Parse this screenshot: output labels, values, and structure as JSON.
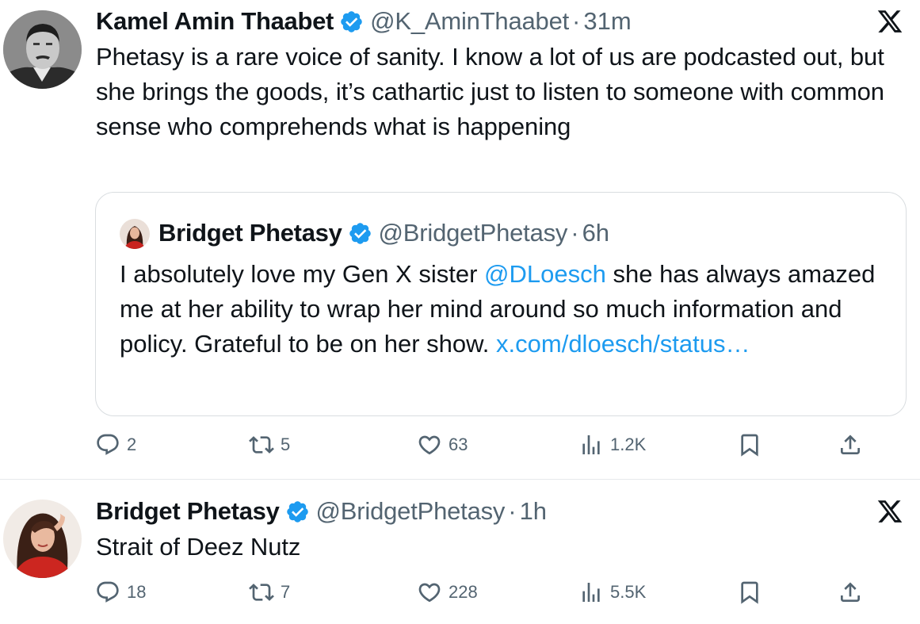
{
  "tweets": [
    {
      "author": {
        "name": "Kamel Amin Thaabet",
        "handle": "@K_AminThaabet",
        "time": "31m"
      },
      "text": "Phetasy is a rare voice of sanity.  I know a lot of us are podcasted out, but she brings the goods, it’s cathartic just to listen to someone with common sense who comprehends what is happening",
      "quote": {
        "author": {
          "name": "Bridget Phetasy",
          "handle": "@BridgetPhetasy",
          "time": "6h"
        },
        "text_before": "I absolutely love my Gen X sister ",
        "mention": "@DLoesch",
        "text_after": " she has always amazed me at her ability to wrap her mind around so much information and policy. Grateful to be on her show. ",
        "link": "x.com/​dloesch/status…"
      },
      "stats": {
        "replies": "2",
        "reposts": "5",
        "likes": "63",
        "views": "1.2K"
      }
    },
    {
      "author": {
        "name": "Bridget Phetasy",
        "handle": "@BridgetPhetasy",
        "time": "1h"
      },
      "text": "Strait of Deez Nutz",
      "stats": {
        "replies": "18",
        "reposts": "7",
        "likes": "228",
        "views": "5.5K"
      }
    }
  ],
  "separator": "·",
  "colors": {
    "text": "#0f1419",
    "secondary": "#536471",
    "link": "#1d9bf0",
    "verified": "#1d9bf0",
    "border": "#d9dde0"
  },
  "icons": [
    "verified-badge-icon",
    "x-logo-icon",
    "reply-icon",
    "repost-icon",
    "like-icon",
    "views-icon",
    "bookmark-icon",
    "share-icon"
  ]
}
